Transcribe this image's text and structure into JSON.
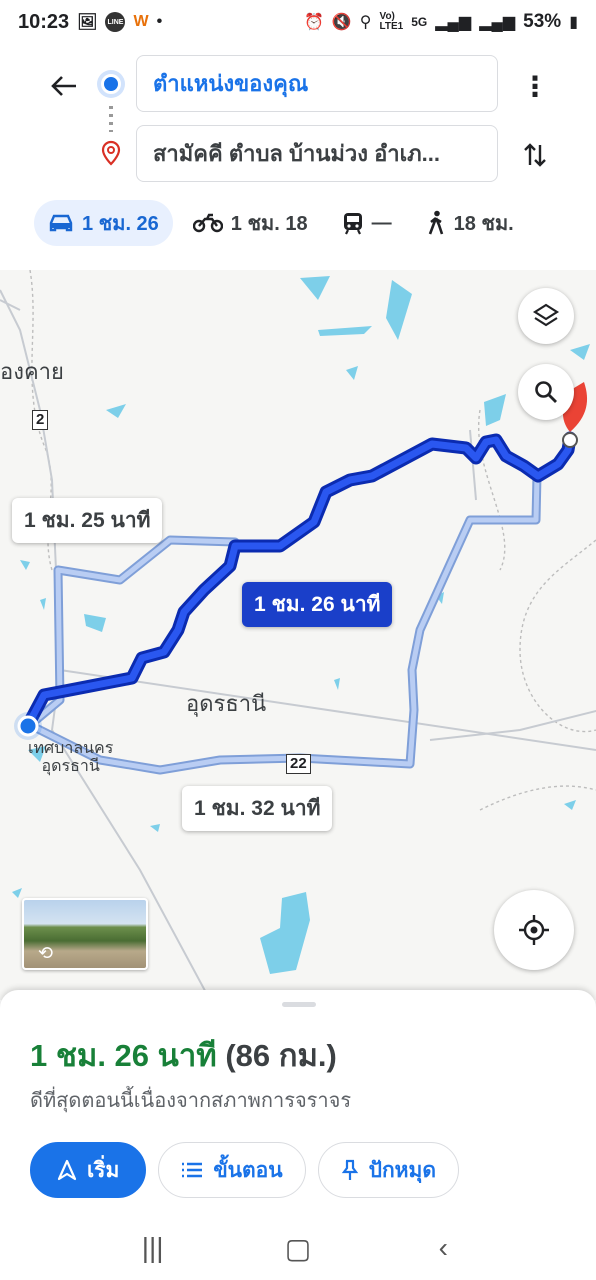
{
  "status_bar": {
    "time": "10:23",
    "battery": "53%",
    "icons": [
      "gallery-icon",
      "line-icon",
      "app-icon",
      "dot-icon",
      "alarm-icon",
      "mute-icon",
      "location-icon",
      "volte-icon",
      "5g-icon",
      "signal-icon",
      "signal-icon",
      "battery-icon"
    ]
  },
  "header": {
    "origin_text": "ตำแหน่งของคุณ",
    "destination_text": "สามัคคี ตำบล บ้านม่วง อำเภ...",
    "modes": [
      {
        "name": "car",
        "label": "1 ชม. 26",
        "active": true
      },
      {
        "name": "motorcycle",
        "label": "1 ชม. 18",
        "active": false
      },
      {
        "name": "transit",
        "label": "—",
        "active": false
      },
      {
        "name": "walk",
        "label": "18 ชม.",
        "active": false
      }
    ]
  },
  "map": {
    "labels": {
      "city_left": "องคาย",
      "province": "อุดรธานี",
      "origin_label": "เทศบาลนคร\nอุดรธานี",
      "origin_label_line1": "เทศบาลนคร",
      "origin_label_line2": "อุดรธานี"
    },
    "route_chips": {
      "alt1": "1 ชม. 25 นาที",
      "primary": "1 ชม. 26 นาที",
      "alt2": "1 ชม. 32 นาที"
    },
    "highway_shields": [
      "2",
      "22"
    ],
    "colors": {
      "route_primary": "#1a3fc9",
      "route_alt": "#a8c0f0",
      "water": "#7dcfe9"
    }
  },
  "sheet": {
    "eta_time": "1 ชม. 26 นาที",
    "eta_distance": "(86 กม.)",
    "subtitle": "ดีที่สุดตอนนี้เนื่องจากสภาพการจราจร",
    "buttons": {
      "start": "เริ่ม",
      "steps": "ขั้นตอน",
      "pin": "ปักหมุด"
    }
  }
}
